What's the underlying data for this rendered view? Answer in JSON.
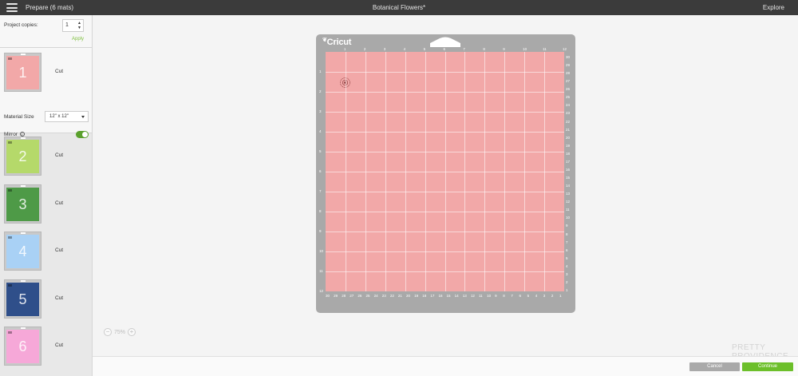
{
  "header": {
    "prepare_label": "Prepare (6 mats)",
    "title": "Botanical Flowers*",
    "explore_label": "Explore"
  },
  "sidebar": {
    "copies_label": "Project copies:",
    "copies_value": "1",
    "apply_label": "Apply",
    "material_size_label": "Material Size",
    "material_size_value": "12\" x 12\"",
    "mirror_label": "Mirror",
    "mirror_on": true,
    "mats": [
      {
        "number": "1",
        "action": "Cut",
        "color": "#f2a8a8"
      },
      {
        "number": "2",
        "action": "Cut",
        "color": "#b5d96a"
      },
      {
        "number": "3",
        "action": "Cut",
        "color": "#4e9a47"
      },
      {
        "number": "4",
        "action": "Cut",
        "color": "#a9d1f5"
      },
      {
        "number": "5",
        "action": "Cut",
        "color": "#2f4f8a"
      },
      {
        "number": "6",
        "action": "Cut",
        "color": "#f6a8d8"
      }
    ]
  },
  "mat": {
    "logo": "Cricut",
    "top_ticks": [
      "1",
      "2",
      "3",
      "4",
      "5",
      "6",
      "7",
      "8",
      "9",
      "10",
      "11",
      "12"
    ],
    "left_ticks": [
      "1",
      "2",
      "3",
      "4",
      "5",
      "6",
      "7",
      "8",
      "9",
      "10",
      "11",
      "12"
    ],
    "right_ticks": [
      "30",
      "29",
      "28",
      "27",
      "26",
      "25",
      "24",
      "23",
      "22",
      "21",
      "20",
      "19",
      "18",
      "17",
      "16",
      "15",
      "14",
      "13",
      "12",
      "11",
      "10",
      "9",
      "8",
      "7",
      "6",
      "5",
      "4",
      "3",
      "2",
      "1"
    ],
    "bottom_ticks": [
      "30",
      "29",
      "28",
      "27",
      "26",
      "25",
      "24",
      "23",
      "22",
      "21",
      "20",
      "19",
      "18",
      "17",
      "16",
      "15",
      "14",
      "13",
      "12",
      "11",
      "10",
      "9",
      "8",
      "7",
      "6",
      "5",
      "4",
      "3",
      "2",
      "1"
    ],
    "cut_color": "#f2a8a8"
  },
  "zoom": {
    "minus": "−",
    "value": "75%",
    "plus": "+"
  },
  "watermark": "PRETTY PROVIDENCE",
  "footer": {
    "cancel_label": "Cancel",
    "continue_label": "Continue"
  }
}
